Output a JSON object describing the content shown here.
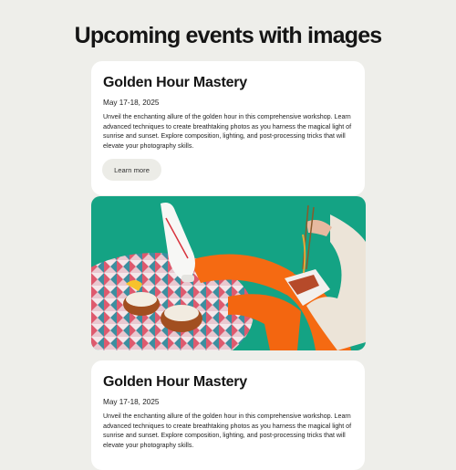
{
  "page": {
    "title": "Upcoming events with images"
  },
  "events": [
    {
      "title": "Golden Hour Mastery",
      "date": "May 17-18, 2025",
      "description": "Unveil the enchanting allure of the golden hour in this comprehensive workshop. Learn advanced techniques to create breathtaking photos as you harness the magical light of sunrise and sunset. Explore composition, lighting, and post-processing tricks that will elevate your photography skills.",
      "button_label": "Learn more"
    },
    {
      "title": "Golden Hour Mastery",
      "date": "May 17-18, 2025",
      "description": "Unveil the enchanting allure of the golden hour in this comprehensive workshop. Learn advanced techniques to create breathtaking photos as you harness the magical light of sunrise and sunset. Explore composition, lighting, and post-processing tricks that will elevate your photography skills."
    }
  ],
  "colors": {
    "page_background": "#eeeeea",
    "card_background": "#ffffff",
    "button_background": "#ecece7",
    "image_backdrop": "#14a384",
    "accent_orange": "#f56a12"
  }
}
